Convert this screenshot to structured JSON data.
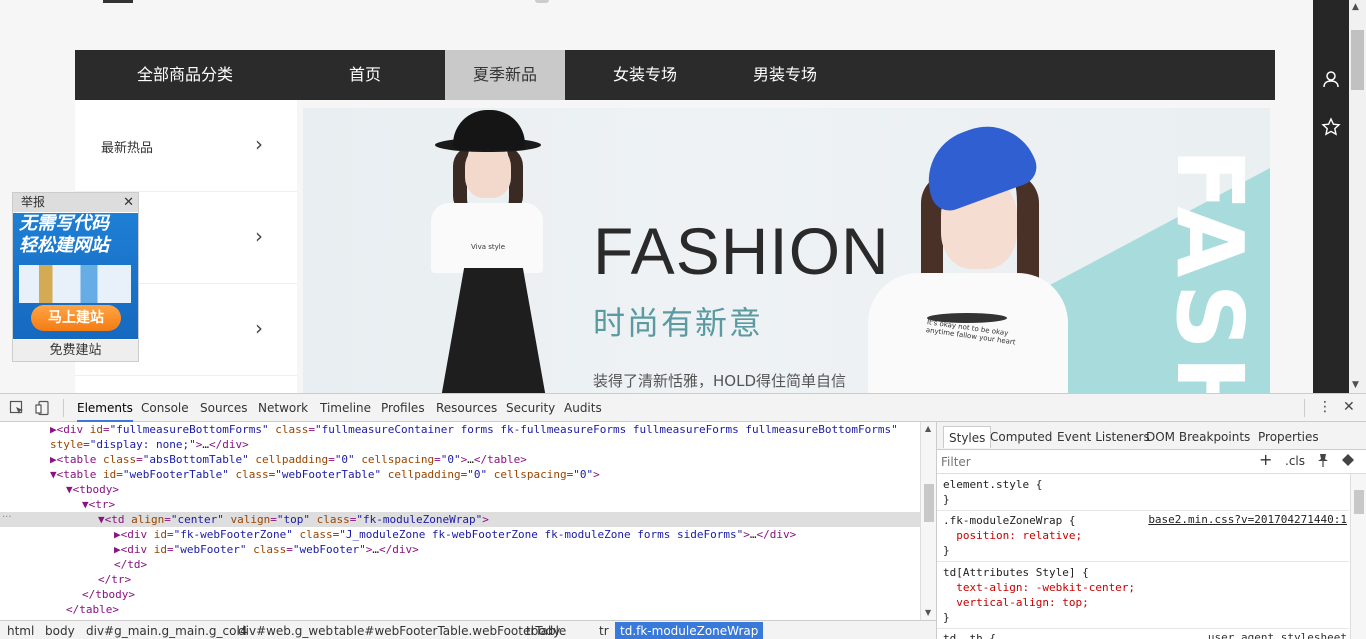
{
  "nav": {
    "items": [
      {
        "label": "全部商品分类"
      },
      {
        "label": "首页"
      },
      {
        "label": "夏季新品"
      },
      {
        "label": "女装专场"
      },
      {
        "label": "男装专场"
      }
    ]
  },
  "side_menu": {
    "items": [
      {
        "label": "最新热品"
      },
      {
        "label": ""
      },
      {
        "label": ""
      }
    ],
    "chevron": "›"
  },
  "banner": {
    "title": "FASHION",
    "subtitle": "时尚有新意",
    "description": "装得了清新恬雅，HOLD得住简单自信",
    "side_text": "FASH",
    "shirt1_text": "Viva style",
    "shirt2_text": "It's okay not to be okay anytime fallow your heart"
  },
  "report_ad": {
    "header": "举报",
    "close": "✕",
    "line1": "无需写代码",
    "line2": "轻松建网站",
    "button": "马上建站",
    "footer": "免费建站"
  },
  "right_rail": {
    "icons": [
      "user-icon",
      "star-icon"
    ]
  },
  "devtools": {
    "tabs": [
      "Elements",
      "Console",
      "Sources",
      "Network",
      "Timeline",
      "Profiles",
      "Resources",
      "Security",
      "Audits"
    ],
    "active_tab": "Elements",
    "dom_lines": [
      {
        "text": "▶<div id=\"fullmeasureBottomForms\" class=\"fullmeasureContainer forms fk-fullmeasureForms fullmeasureForms fullmeasureBottomForms\"",
        "indent": 6
      },
      {
        "text": "style=\"display: none;\">…</div>",
        "indent": 6
      },
      {
        "text": "▶<table class=\"absBottomTable\" cellpadding=\"0\" cellspacing=\"0\">…</table>",
        "indent": 6
      },
      {
        "text": "▼<table id=\"webFooterTable\" class=\"webFooterTable\" cellpadding=\"0\" cellspacing=\"0\">",
        "indent": 6
      },
      {
        "text": "▼<tbody>",
        "indent": 8
      },
      {
        "text": "▼<tr>",
        "indent": 10
      },
      {
        "text": "▼<td align=\"center\" valign=\"top\" class=\"fk-moduleZoneWrap\">",
        "indent": 12
      },
      {
        "text": "▶<div id=\"fk-webFooterZone\" class=\"J_moduleZone fk-webFooterZone fk-moduleZone forms sideForms\">…</div>",
        "indent": 14
      },
      {
        "text": "▶<div id=\"webFooter\" class=\"webFooter\">…</div>",
        "indent": 14
      },
      {
        "text": "</td>",
        "indent": 14
      },
      {
        "text": "</tr>",
        "indent": 12
      },
      {
        "text": "</tbody>",
        "indent": 10
      },
      {
        "text": "</table>",
        "indent": 8
      }
    ],
    "selected_line": 6,
    "breadcrumbs": [
      "html",
      "body",
      "div#g_main.g_main.g_col4",
      "div#web.g_web",
      "table#webFooterTable.webFooterTable",
      "tbody",
      "tr",
      "td.fk-moduleZoneWrap"
    ],
    "styles_tabs": [
      "Styles",
      "Computed",
      "Event Listeners",
      "DOM Breakpoints",
      "Properties"
    ],
    "filter_placeholder": "Filter",
    "filter_add": "+",
    "filter_cls": ".cls",
    "rules": [
      {
        "lines": [
          "element.style {",
          "}"
        ],
        "source": ""
      },
      {
        "lines": [
          ".fk-moduleZoneWrap {",
          "  position: relative;",
          "}"
        ],
        "source": "base2.min.css?v=201704271440:1"
      },
      {
        "lines": [
          "td[Attributes Style] {",
          "  text-align: -webkit-center;",
          "  vertical-align: top;",
          "}"
        ],
        "source": ""
      },
      {
        "lines": [
          "td, th {"
        ],
        "source": "user agent stylesheet"
      }
    ]
  }
}
